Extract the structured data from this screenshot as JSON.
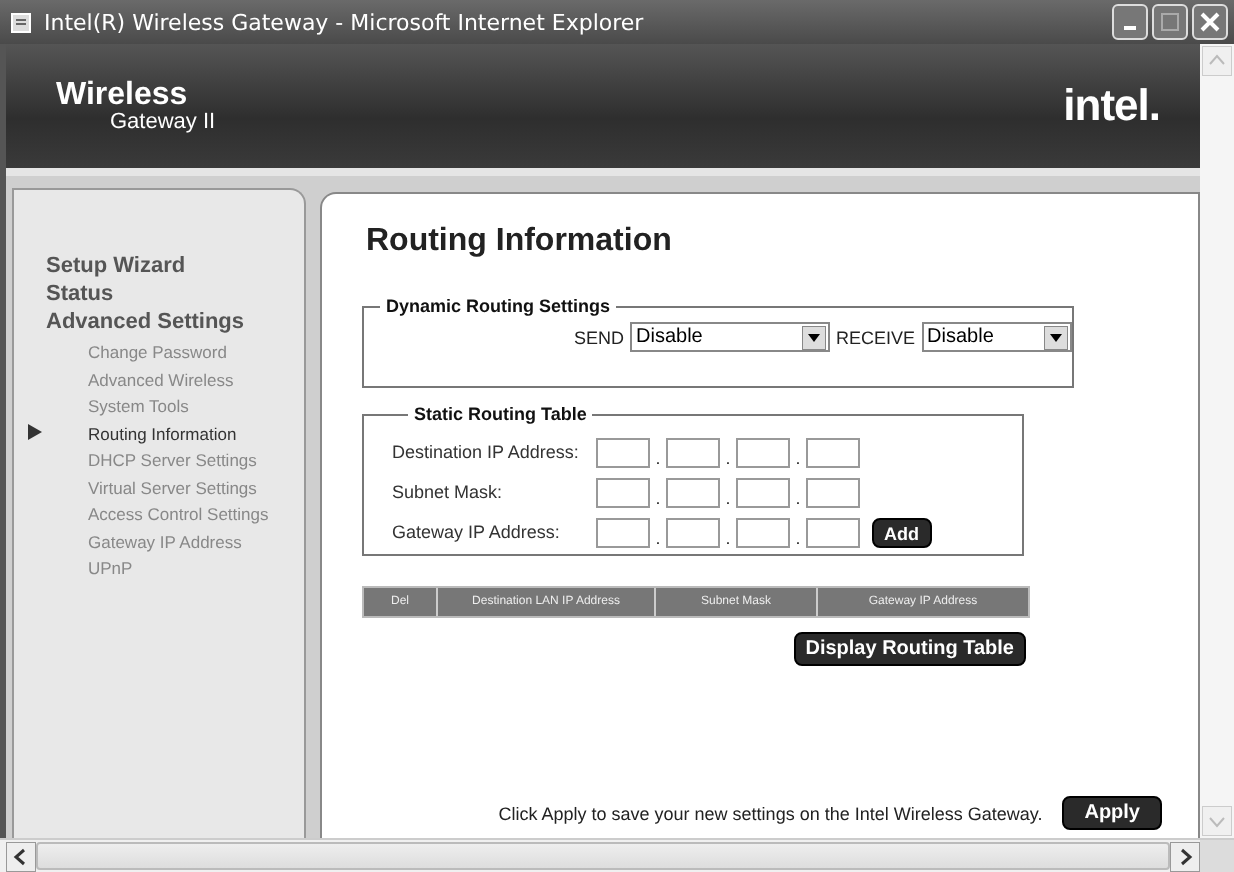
{
  "window": {
    "title": "Intel(R) Wireless Gateway - Microsoft Internet Explorer"
  },
  "header": {
    "product_line1": "Wireless",
    "product_line2": "Gateway II",
    "brand": "intel."
  },
  "sidebar": {
    "items": [
      {
        "label": "Setup Wizard",
        "selected": false
      },
      {
        "label": "Status",
        "selected": false
      },
      {
        "label": "Advanced Settings",
        "selected": false,
        "children": [
          {
            "label": "Change Password",
            "selected": false
          },
          {
            "label": "Advanced Wireless",
            "selected": false
          },
          {
            "label": "System Tools",
            "selected": false
          },
          {
            "label": "Routing Information",
            "selected": true
          },
          {
            "label": "DHCP Server Settings",
            "selected": false
          },
          {
            "label": "Virtual Server Settings",
            "selected": false
          },
          {
            "label": "Access Control Settings",
            "selected": false
          },
          {
            "label": "Gateway IP Address",
            "selected": false
          },
          {
            "label": "UPnP",
            "selected": false
          }
        ]
      }
    ]
  },
  "main": {
    "title": "Routing Information",
    "dynamic_routing": {
      "legend": "Dynamic Routing Settings",
      "send_label": "SEND",
      "send_value": "Disable",
      "receive_label": "RECEIVE",
      "receive_value": "Disable"
    },
    "static_routing": {
      "legend": "Static Routing Table",
      "separator": ".",
      "rows": [
        {
          "label": "Destination IP Address:"
        },
        {
          "label": "Subnet Mask:"
        },
        {
          "label": "Gateway IP Address:"
        }
      ],
      "add_button": "Add"
    },
    "table": {
      "columns": [
        "Del",
        "Destination LAN IP Address",
        "Subnet Mask",
        "Gateway IP Address"
      ]
    },
    "display_button": "Display Routing Table",
    "apply_note": "Click Apply to save your new settings on the Intel Wireless Gateway.",
    "apply_button": "Apply"
  }
}
